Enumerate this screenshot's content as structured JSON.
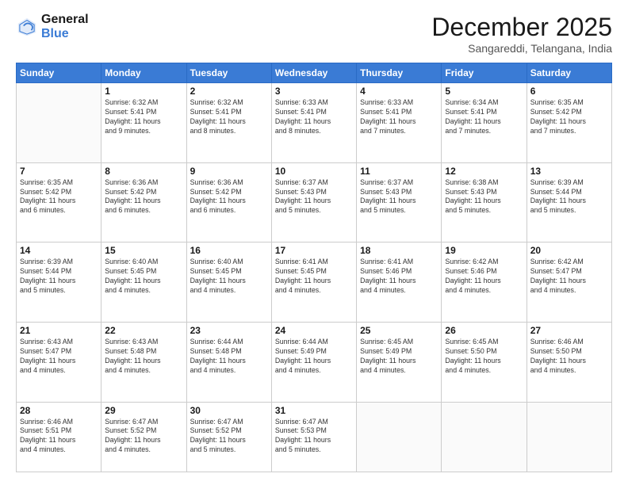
{
  "logo": {
    "line1": "General",
    "line2": "Blue"
  },
  "header": {
    "month": "December 2025",
    "location": "Sangareddi, Telangana, India"
  },
  "days": [
    "Sunday",
    "Monday",
    "Tuesday",
    "Wednesday",
    "Thursday",
    "Friday",
    "Saturday"
  ],
  "weeks": [
    [
      {
        "day": "",
        "info": ""
      },
      {
        "day": "1",
        "info": "Sunrise: 6:32 AM\nSunset: 5:41 PM\nDaylight: 11 hours\nand 9 minutes."
      },
      {
        "day": "2",
        "info": "Sunrise: 6:32 AM\nSunset: 5:41 PM\nDaylight: 11 hours\nand 8 minutes."
      },
      {
        "day": "3",
        "info": "Sunrise: 6:33 AM\nSunset: 5:41 PM\nDaylight: 11 hours\nand 8 minutes."
      },
      {
        "day": "4",
        "info": "Sunrise: 6:33 AM\nSunset: 5:41 PM\nDaylight: 11 hours\nand 7 minutes."
      },
      {
        "day": "5",
        "info": "Sunrise: 6:34 AM\nSunset: 5:41 PM\nDaylight: 11 hours\nand 7 minutes."
      },
      {
        "day": "6",
        "info": "Sunrise: 6:35 AM\nSunset: 5:42 PM\nDaylight: 11 hours\nand 7 minutes."
      }
    ],
    [
      {
        "day": "7",
        "info": "Sunrise: 6:35 AM\nSunset: 5:42 PM\nDaylight: 11 hours\nand 6 minutes."
      },
      {
        "day": "8",
        "info": "Sunrise: 6:36 AM\nSunset: 5:42 PM\nDaylight: 11 hours\nand 6 minutes."
      },
      {
        "day": "9",
        "info": "Sunrise: 6:36 AM\nSunset: 5:42 PM\nDaylight: 11 hours\nand 6 minutes."
      },
      {
        "day": "10",
        "info": "Sunrise: 6:37 AM\nSunset: 5:43 PM\nDaylight: 11 hours\nand 5 minutes."
      },
      {
        "day": "11",
        "info": "Sunrise: 6:37 AM\nSunset: 5:43 PM\nDaylight: 11 hours\nand 5 minutes."
      },
      {
        "day": "12",
        "info": "Sunrise: 6:38 AM\nSunset: 5:43 PM\nDaylight: 11 hours\nand 5 minutes."
      },
      {
        "day": "13",
        "info": "Sunrise: 6:39 AM\nSunset: 5:44 PM\nDaylight: 11 hours\nand 5 minutes."
      }
    ],
    [
      {
        "day": "14",
        "info": "Sunrise: 6:39 AM\nSunset: 5:44 PM\nDaylight: 11 hours\nand 5 minutes."
      },
      {
        "day": "15",
        "info": "Sunrise: 6:40 AM\nSunset: 5:45 PM\nDaylight: 11 hours\nand 4 minutes."
      },
      {
        "day": "16",
        "info": "Sunrise: 6:40 AM\nSunset: 5:45 PM\nDaylight: 11 hours\nand 4 minutes."
      },
      {
        "day": "17",
        "info": "Sunrise: 6:41 AM\nSunset: 5:45 PM\nDaylight: 11 hours\nand 4 minutes."
      },
      {
        "day": "18",
        "info": "Sunrise: 6:41 AM\nSunset: 5:46 PM\nDaylight: 11 hours\nand 4 minutes."
      },
      {
        "day": "19",
        "info": "Sunrise: 6:42 AM\nSunset: 5:46 PM\nDaylight: 11 hours\nand 4 minutes."
      },
      {
        "day": "20",
        "info": "Sunrise: 6:42 AM\nSunset: 5:47 PM\nDaylight: 11 hours\nand 4 minutes."
      }
    ],
    [
      {
        "day": "21",
        "info": "Sunrise: 6:43 AM\nSunset: 5:47 PM\nDaylight: 11 hours\nand 4 minutes."
      },
      {
        "day": "22",
        "info": "Sunrise: 6:43 AM\nSunset: 5:48 PM\nDaylight: 11 hours\nand 4 minutes."
      },
      {
        "day": "23",
        "info": "Sunrise: 6:44 AM\nSunset: 5:48 PM\nDaylight: 11 hours\nand 4 minutes."
      },
      {
        "day": "24",
        "info": "Sunrise: 6:44 AM\nSunset: 5:49 PM\nDaylight: 11 hours\nand 4 minutes."
      },
      {
        "day": "25",
        "info": "Sunrise: 6:45 AM\nSunset: 5:49 PM\nDaylight: 11 hours\nand 4 minutes."
      },
      {
        "day": "26",
        "info": "Sunrise: 6:45 AM\nSunset: 5:50 PM\nDaylight: 11 hours\nand 4 minutes."
      },
      {
        "day": "27",
        "info": "Sunrise: 6:46 AM\nSunset: 5:50 PM\nDaylight: 11 hours\nand 4 minutes."
      }
    ],
    [
      {
        "day": "28",
        "info": "Sunrise: 6:46 AM\nSunset: 5:51 PM\nDaylight: 11 hours\nand 4 minutes."
      },
      {
        "day": "29",
        "info": "Sunrise: 6:47 AM\nSunset: 5:52 PM\nDaylight: 11 hours\nand 4 minutes."
      },
      {
        "day": "30",
        "info": "Sunrise: 6:47 AM\nSunset: 5:52 PM\nDaylight: 11 hours\nand 5 minutes."
      },
      {
        "day": "31",
        "info": "Sunrise: 6:47 AM\nSunset: 5:53 PM\nDaylight: 11 hours\nand 5 minutes."
      },
      {
        "day": "",
        "info": ""
      },
      {
        "day": "",
        "info": ""
      },
      {
        "day": "",
        "info": ""
      }
    ]
  ]
}
